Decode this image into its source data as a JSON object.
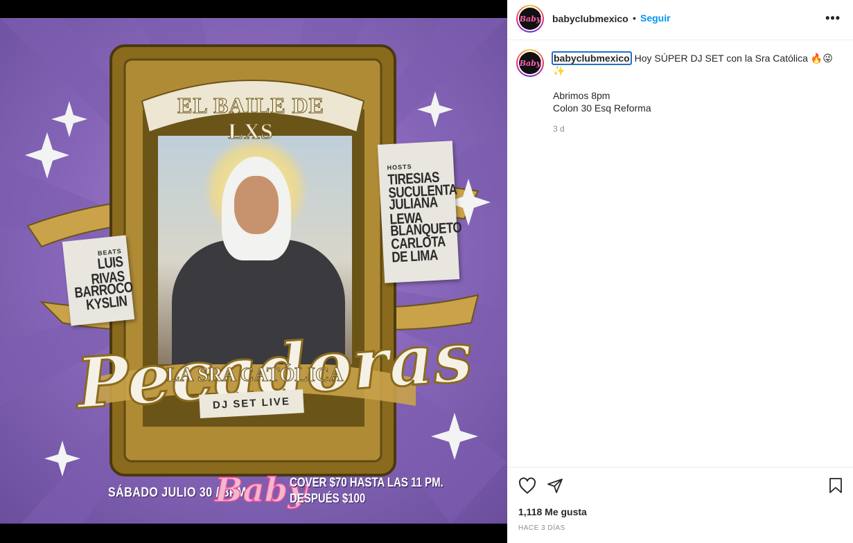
{
  "post": {
    "poster": {
      "title_top": "EL BAILE DE LXS",
      "beats_label": "BEATS",
      "beats": [
        "LUIS RIVAS",
        "BARROCO",
        "KYSLIN"
      ],
      "hosts_label": "HOSTS",
      "hosts": [
        "TIRESIAS",
        "SUCULENTA",
        "JULIANA LEWA",
        "BLANQUETO",
        "CARLOTA",
        "DE LIMA"
      ],
      "main_title": "Pecadoras",
      "subtitle": "LA SRA CATÓLICA",
      "djset": "DJ SET LIVE",
      "date": "SÁBADO JULIO 30 / 8PM",
      "logo": "Baby",
      "cover_line1": "COVER $70 HASTA LAS 11 PM.",
      "cover_line2": "DESPUÉS $100"
    }
  },
  "header": {
    "avatar_text": "Baby",
    "username": "babyclubmexico",
    "separator": "•",
    "follow_label": "Seguir",
    "more_icon": "•••"
  },
  "caption": {
    "avatar_text": "Baby",
    "username": "babyclubmexico",
    "text": "Hoy SÚPER DJ SET con la Sra Católica 🔥😜✨",
    "line1": "Abrimos 8pm",
    "line2": "Colon 30 Esq Reforma",
    "time": "3 d"
  },
  "footer": {
    "likes": "1,118 Me gusta",
    "date": "HACE 3 DÍAS"
  },
  "icons": {
    "like": "heart-icon",
    "share": "paper-plane-icon",
    "save": "bookmark-icon"
  },
  "colors": {
    "follow_blue": "#0095f6",
    "poster_purple": "#8e6cc0",
    "gold": "#c9a24a"
  }
}
